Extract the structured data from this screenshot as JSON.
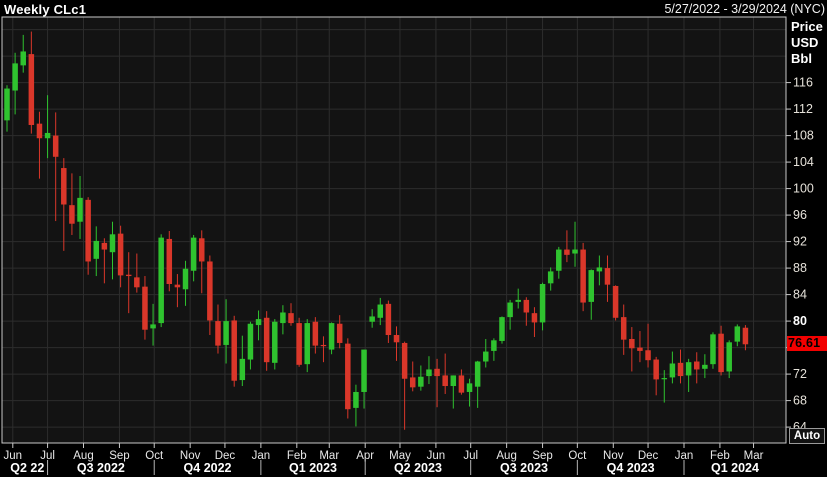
{
  "header": {
    "title": "Weekly CLc1",
    "date_range": "5/27/2022 - 3/29/2024 (NYC)"
  },
  "y_axis": {
    "unit_lines": [
      "Price",
      "USD",
      "Bbl"
    ],
    "ticks": [
      116,
      112,
      108,
      104,
      100,
      96,
      92,
      88,
      84,
      80,
      76,
      72,
      68,
      64
    ],
    "bold_tick": 80,
    "hidden_by_badge": 76,
    "last_price_label": "76.61",
    "auto_label": "Auto"
  },
  "x_axis": {
    "months": [
      {
        "label": "Jun",
        "date": "2022-06-01"
      },
      {
        "label": "Jul",
        "date": "2022-07-01"
      },
      {
        "label": "Aug",
        "date": "2022-08-01"
      },
      {
        "label": "Sep",
        "date": "2022-09-01"
      },
      {
        "label": "Oct",
        "date": "2022-10-01"
      },
      {
        "label": "Nov",
        "date": "2022-11-01"
      },
      {
        "label": "Dec",
        "date": "2022-12-01"
      },
      {
        "label": "Jan",
        "date": "2023-01-01"
      },
      {
        "label": "Feb",
        "date": "2023-02-01"
      },
      {
        "label": "Mar",
        "date": "2023-03-01"
      },
      {
        "label": "Apr",
        "date": "2023-04-01"
      },
      {
        "label": "May",
        "date": "2023-05-01"
      },
      {
        "label": "Jun",
        "date": "2023-06-01"
      },
      {
        "label": "Jul",
        "date": "2023-07-01"
      },
      {
        "label": "Aug",
        "date": "2023-08-01"
      },
      {
        "label": "Sep",
        "date": "2023-09-01"
      },
      {
        "label": "Oct",
        "date": "2023-10-01"
      },
      {
        "label": "Nov",
        "date": "2023-11-01"
      },
      {
        "label": "Dec",
        "date": "2023-12-01"
      },
      {
        "label": "Jan",
        "date": "2024-01-01"
      },
      {
        "label": "Feb",
        "date": "2024-02-01"
      },
      {
        "label": "Mar",
        "date": "2024-03-01"
      }
    ],
    "quarters": [
      {
        "label": "Q2 22",
        "start": "2022-05-27",
        "end": "2022-07-01"
      },
      {
        "label": "Q3 2022",
        "start": "2022-07-01",
        "end": "2022-10-01"
      },
      {
        "label": "Q4 2022",
        "start": "2022-10-01",
        "end": "2023-01-01"
      },
      {
        "label": "Q1 2023",
        "start": "2023-01-01",
        "end": "2023-04-01"
      },
      {
        "label": "Q2 2023",
        "start": "2023-04-01",
        "end": "2023-07-01"
      },
      {
        "label": "Q3 2023",
        "start": "2023-07-01",
        "end": "2023-10-01"
      },
      {
        "label": "Q4 2023",
        "start": "2023-10-01",
        "end": "2024-01-01"
      },
      {
        "label": "Q1 2024",
        "start": "2024-01-01",
        "end": "2024-03-29"
      }
    ]
  },
  "chart_data": {
    "type": "candlestick",
    "title": "Weekly CLc1",
    "symbol": "CLc1",
    "interval": "weekly",
    "ylabel": "Price USD Bbl",
    "ylim": [
      61.6,
      125.9
    ],
    "price_tick_step": 4,
    "time_range": [
      "2022-05-27",
      "2024-03-29"
    ],
    "last_price": 76.61,
    "grid": true,
    "candles": [
      {
        "d": "2022-05-27",
        "o": 110.3,
        "h": 115.6,
        "l": 108.6,
        "c": 115.1
      },
      {
        "d": "2022-06-03",
        "o": 114.8,
        "h": 120.5,
        "l": 111.2,
        "c": 118.9
      },
      {
        "d": "2022-06-10",
        "o": 118.6,
        "h": 123.2,
        "l": 117.5,
        "c": 120.7
      },
      {
        "d": "2022-06-17",
        "o": 120.3,
        "h": 123.7,
        "l": 108.3,
        "c": 109.6
      },
      {
        "d": "2022-06-24",
        "o": 109.8,
        "h": 111.6,
        "l": 101.5,
        "c": 107.6
      },
      {
        "d": "2022-07-01",
        "o": 107.6,
        "h": 114.1,
        "l": 104.6,
        "c": 108.4
      },
      {
        "d": "2022-07-08",
        "o": 108.0,
        "h": 111.5,
        "l": 95.1,
        "c": 104.8
      },
      {
        "d": "2022-07-15",
        "o": 103.1,
        "h": 104.6,
        "l": 90.6,
        "c": 97.6
      },
      {
        "d": "2022-07-22",
        "o": 97.5,
        "h": 102.3,
        "l": 93.0,
        "c": 94.7
      },
      {
        "d": "2022-07-29",
        "o": 95.0,
        "h": 101.9,
        "l": 92.4,
        "c": 98.6
      },
      {
        "d": "2022-08-05",
        "o": 98.3,
        "h": 98.7,
        "l": 87.0,
        "c": 89.0
      },
      {
        "d": "2022-08-12",
        "o": 89.4,
        "h": 94.3,
        "l": 86.8,
        "c": 92.1
      },
      {
        "d": "2022-08-19",
        "o": 91.8,
        "h": 92.5,
        "l": 85.7,
        "c": 90.8
      },
      {
        "d": "2022-08-26",
        "o": 90.4,
        "h": 95.0,
        "l": 86.3,
        "c": 93.1
      },
      {
        "d": "2022-09-02",
        "o": 93.2,
        "h": 94.4,
        "l": 85.1,
        "c": 86.9
      },
      {
        "d": "2022-09-09",
        "o": 87.0,
        "h": 90.4,
        "l": 81.2,
        "c": 86.8
      },
      {
        "d": "2022-09-16",
        "o": 86.6,
        "h": 90.2,
        "l": 84.3,
        "c": 85.1
      },
      {
        "d": "2022-09-23",
        "o": 85.2,
        "h": 86.8,
        "l": 77.2,
        "c": 78.7
      },
      {
        "d": "2022-09-30",
        "o": 78.9,
        "h": 82.6,
        "l": 76.3,
        "c": 79.5
      },
      {
        "d": "2022-10-07",
        "o": 79.7,
        "h": 93.1,
        "l": 79.1,
        "c": 92.6
      },
      {
        "d": "2022-10-14",
        "o": 92.4,
        "h": 93.6,
        "l": 84.5,
        "c": 85.6
      },
      {
        "d": "2022-10-21",
        "o": 85.5,
        "h": 87.1,
        "l": 82.1,
        "c": 85.1
      },
      {
        "d": "2022-10-28",
        "o": 84.8,
        "h": 89.1,
        "l": 82.3,
        "c": 87.9
      },
      {
        "d": "2022-11-04",
        "o": 87.6,
        "h": 93.0,
        "l": 86.0,
        "c": 92.6
      },
      {
        "d": "2022-11-11",
        "o": 92.5,
        "h": 93.7,
        "l": 84.2,
        "c": 89.0
      },
      {
        "d": "2022-11-18",
        "o": 89.0,
        "h": 89.9,
        "l": 77.9,
        "c": 80.1
      },
      {
        "d": "2022-11-25",
        "o": 80.0,
        "h": 82.5,
        "l": 75.1,
        "c": 76.3
      },
      {
        "d": "2022-12-02",
        "o": 76.4,
        "h": 83.3,
        "l": 73.6,
        "c": 80.0
      },
      {
        "d": "2022-12-09",
        "o": 80.1,
        "h": 80.8,
        "l": 70.1,
        "c": 71.0
      },
      {
        "d": "2022-12-16",
        "o": 71.1,
        "h": 77.8,
        "l": 70.2,
        "c": 74.3
      },
      {
        "d": "2022-12-23",
        "o": 74.2,
        "h": 79.9,
        "l": 72.7,
        "c": 79.6
      },
      {
        "d": "2022-12-30",
        "o": 79.4,
        "h": 81.6,
        "l": 77.1,
        "c": 80.3
      },
      {
        "d": "2023-01-06",
        "o": 80.5,
        "h": 81.5,
        "l": 72.5,
        "c": 73.8
      },
      {
        "d": "2023-01-13",
        "o": 73.7,
        "h": 80.3,
        "l": 72.7,
        "c": 79.9
      },
      {
        "d": "2023-01-20",
        "o": 79.7,
        "h": 82.4,
        "l": 78.0,
        "c": 81.3
      },
      {
        "d": "2023-01-27",
        "o": 81.2,
        "h": 82.7,
        "l": 79.3,
        "c": 79.7
      },
      {
        "d": "2023-02-03",
        "o": 79.7,
        "h": 80.5,
        "l": 73.1,
        "c": 73.4
      },
      {
        "d": "2023-02-10",
        "o": 73.5,
        "h": 80.3,
        "l": 72.3,
        "c": 79.7
      },
      {
        "d": "2023-02-17",
        "o": 79.9,
        "h": 80.6,
        "l": 75.1,
        "c": 76.3
      },
      {
        "d": "2023-02-24",
        "o": 76.4,
        "h": 77.7,
        "l": 73.8,
        "c": 76.3
      },
      {
        "d": "2023-03-03",
        "o": 75.7,
        "h": 79.8,
        "l": 75.0,
        "c": 79.7
      },
      {
        "d": "2023-03-10",
        "o": 79.6,
        "h": 80.9,
        "l": 75.9,
        "c": 76.7
      },
      {
        "d": "2023-03-17",
        "o": 76.6,
        "h": 77.4,
        "l": 65.3,
        "c": 66.7
      },
      {
        "d": "2023-03-24",
        "o": 66.9,
        "h": 70.4,
        "l": 64.1,
        "c": 69.3
      },
      {
        "d": "2023-03-31",
        "o": 69.3,
        "h": 75.7,
        "l": 66.8,
        "c": 75.7
      },
      {
        "d": "2023-04-07",
        "o": 79.9,
        "h": 81.8,
        "l": 79.0,
        "c": 80.7
      },
      {
        "d": "2023-04-14",
        "o": 80.5,
        "h": 83.5,
        "l": 79.4,
        "c": 82.5
      },
      {
        "d": "2023-04-21",
        "o": 82.6,
        "h": 83.1,
        "l": 76.7,
        "c": 77.9
      },
      {
        "d": "2023-04-28",
        "o": 77.9,
        "h": 79.2,
        "l": 74.0,
        "c": 76.8
      },
      {
        "d": "2023-05-05",
        "o": 76.7,
        "h": 76.9,
        "l": 63.6,
        "c": 71.3
      },
      {
        "d": "2023-05-12",
        "o": 71.5,
        "h": 73.9,
        "l": 69.4,
        "c": 70.0
      },
      {
        "d": "2023-05-19",
        "o": 70.1,
        "h": 73.3,
        "l": 69.5,
        "c": 71.6
      },
      {
        "d": "2023-05-26",
        "o": 71.7,
        "h": 74.7,
        "l": 70.5,
        "c": 72.7
      },
      {
        "d": "2023-06-02",
        "o": 72.8,
        "h": 74.3,
        "l": 67.0,
        "c": 71.7
      },
      {
        "d": "2023-06-09",
        "o": 71.8,
        "h": 75.1,
        "l": 69.0,
        "c": 70.2
      },
      {
        "d": "2023-06-16",
        "o": 70.2,
        "h": 71.8,
        "l": 66.8,
        "c": 71.8
      },
      {
        "d": "2023-06-23",
        "o": 71.8,
        "h": 72.7,
        "l": 68.9,
        "c": 69.2
      },
      {
        "d": "2023-06-30",
        "o": 69.3,
        "h": 71.3,
        "l": 67.1,
        "c": 70.6
      },
      {
        "d": "2023-07-07",
        "o": 70.1,
        "h": 74.0,
        "l": 66.9,
        "c": 73.9
      },
      {
        "d": "2023-07-14",
        "o": 73.9,
        "h": 77.3,
        "l": 73.0,
        "c": 75.4
      },
      {
        "d": "2023-07-21",
        "o": 75.5,
        "h": 77.4,
        "l": 74.0,
        "c": 77.1
      },
      {
        "d": "2023-07-28",
        "o": 77.0,
        "h": 80.7,
        "l": 76.6,
        "c": 80.6
      },
      {
        "d": "2023-08-04",
        "o": 80.6,
        "h": 83.2,
        "l": 78.7,
        "c": 82.8
      },
      {
        "d": "2023-08-11",
        "o": 82.9,
        "h": 84.9,
        "l": 81.9,
        "c": 83.2
      },
      {
        "d": "2023-08-18",
        "o": 83.2,
        "h": 83.6,
        "l": 79.3,
        "c": 81.3
      },
      {
        "d": "2023-08-25",
        "o": 81.2,
        "h": 82.1,
        "l": 77.6,
        "c": 79.8
      },
      {
        "d": "2023-09-01",
        "o": 79.8,
        "h": 85.8,
        "l": 78.6,
        "c": 85.6
      },
      {
        "d": "2023-09-08",
        "o": 85.7,
        "h": 88.1,
        "l": 84.6,
        "c": 87.5
      },
      {
        "d": "2023-09-15",
        "o": 87.6,
        "h": 91.2,
        "l": 86.4,
        "c": 90.8
      },
      {
        "d": "2023-09-22",
        "o": 90.8,
        "h": 93.7,
        "l": 88.9,
        "c": 90.0
      },
      {
        "d": "2023-09-29",
        "o": 90.2,
        "h": 95.0,
        "l": 88.2,
        "c": 90.8
      },
      {
        "d": "2023-10-06",
        "o": 90.8,
        "h": 91.8,
        "l": 81.5,
        "c": 82.8
      },
      {
        "d": "2023-10-13",
        "o": 82.9,
        "h": 87.8,
        "l": 80.2,
        "c": 87.7
      },
      {
        "d": "2023-10-20",
        "o": 87.5,
        "h": 89.9,
        "l": 85.4,
        "c": 88.1
      },
      {
        "d": "2023-10-27",
        "o": 88.0,
        "h": 89.9,
        "l": 82.9,
        "c": 85.5
      },
      {
        "d": "2023-11-03",
        "o": 85.3,
        "h": 85.4,
        "l": 80.1,
        "c": 80.5
      },
      {
        "d": "2023-11-10",
        "o": 80.6,
        "h": 82.5,
        "l": 74.9,
        "c": 77.2
      },
      {
        "d": "2023-11-17",
        "o": 77.3,
        "h": 79.1,
        "l": 72.4,
        "c": 75.9
      },
      {
        "d": "2023-11-24",
        "o": 76.0,
        "h": 78.5,
        "l": 73.8,
        "c": 75.5
      },
      {
        "d": "2023-12-01",
        "o": 75.6,
        "h": 79.6,
        "l": 73.0,
        "c": 74.1
      },
      {
        "d": "2023-12-08",
        "o": 74.2,
        "h": 74.6,
        "l": 68.8,
        "c": 71.2
      },
      {
        "d": "2023-12-15",
        "o": 71.3,
        "h": 72.6,
        "l": 67.7,
        "c": 71.4
      },
      {
        "d": "2023-12-22",
        "o": 71.5,
        "h": 75.4,
        "l": 70.6,
        "c": 73.6
      },
      {
        "d": "2023-12-29",
        "o": 73.7,
        "h": 75.7,
        "l": 70.6,
        "c": 71.7
      },
      {
        "d": "2024-01-05",
        "o": 71.8,
        "h": 74.3,
        "l": 69.3,
        "c": 73.8
      },
      {
        "d": "2024-01-12",
        "o": 73.9,
        "h": 75.3,
        "l": 70.6,
        "c": 72.7
      },
      {
        "d": "2024-01-19",
        "o": 72.8,
        "h": 75.0,
        "l": 71.4,
        "c": 73.4
      },
      {
        "d": "2024-01-26",
        "o": 73.5,
        "h": 78.3,
        "l": 72.8,
        "c": 78.0
      },
      {
        "d": "2024-02-02",
        "o": 78.1,
        "h": 79.3,
        "l": 71.8,
        "c": 72.3
      },
      {
        "d": "2024-02-09",
        "o": 72.4,
        "h": 77.1,
        "l": 71.4,
        "c": 76.8
      },
      {
        "d": "2024-02-16",
        "o": 76.9,
        "h": 79.5,
        "l": 76.2,
        "c": 79.2
      },
      {
        "d": "2024-02-23",
        "o": 79.0,
        "h": 79.4,
        "l": 75.6,
        "c": 76.5
      }
    ]
  },
  "colors": {
    "up": "#2fc32f",
    "down": "#da372a",
    "badge_bg": "#f20000",
    "badge_text": "#000000",
    "grid": "#2d2d2d",
    "frame": "#c9c9c9",
    "bg": "#000000",
    "plot_bg": "#131313",
    "tick_text": "#e6e2da",
    "bold_tick_text": "#ffffff",
    "month_text": "#e8e8e8",
    "quarter_text": "#ffffff"
  }
}
